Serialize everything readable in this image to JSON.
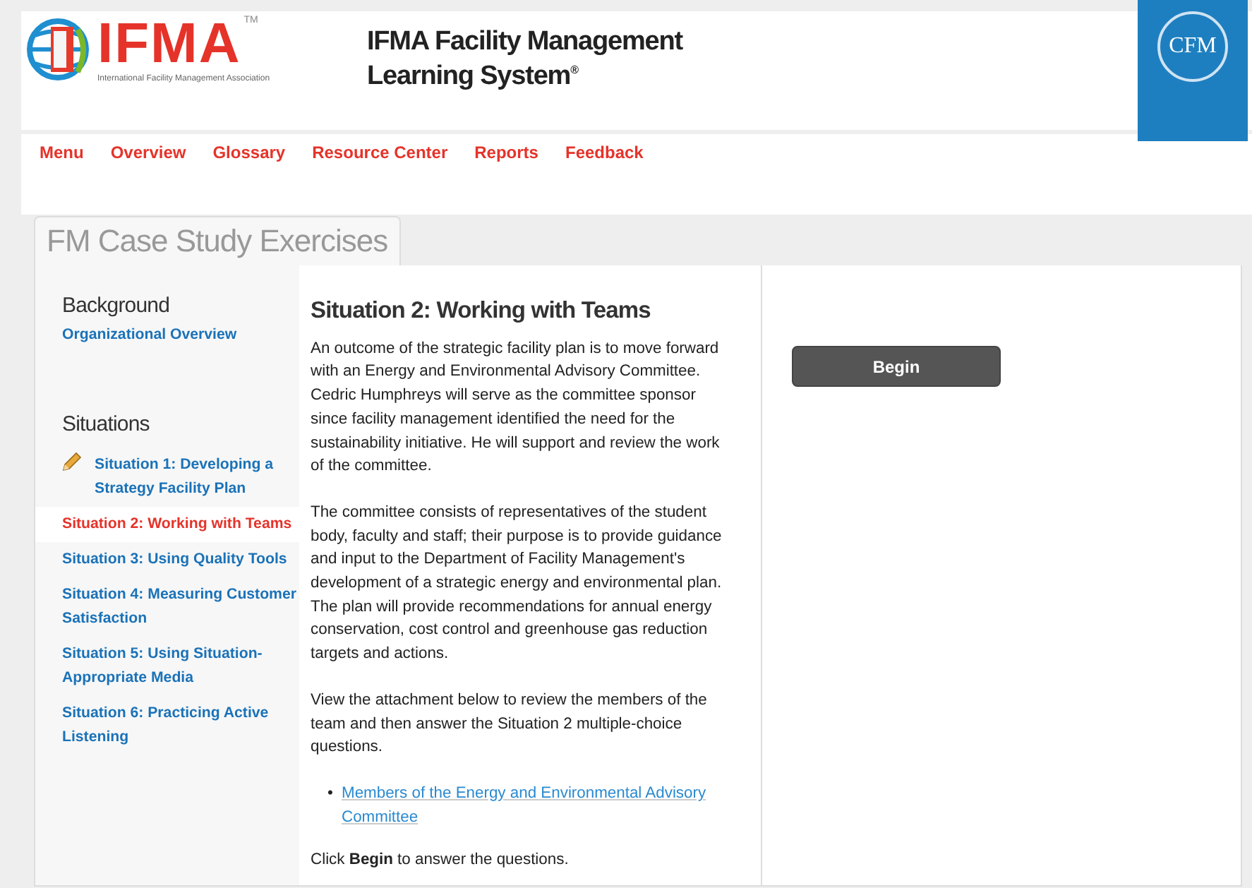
{
  "header": {
    "logo_text": "IFMA",
    "logo_tm": "TM",
    "logo_tagline": "International Facility Management Association",
    "title_line1": "IFMA Facility Management",
    "title_line2": "Learning System$^{®}$",
    "badge_text": "CFM"
  },
  "nav": [
    "Menu",
    "Overview",
    "Glossary",
    "Resource Center",
    "Reports",
    "Feedback"
  ],
  "tab": {
    "label": "FM Case Study Exercises"
  },
  "sidebar": {
    "background_heading": "Background",
    "background_items": [
      {
        "label": "Organizational Overview",
        "selected": false
      }
    ],
    "situations_heading": "Situations",
    "situations": [
      {
        "label": "Situation 1: Developing a Strategy Facility Plan",
        "selected": false,
        "in_progress": true
      },
      {
        "label": "Situation 2: Working with Teams",
        "selected": true,
        "in_progress": false
      },
      {
        "label": "Situation 3: Using Quality Tools",
        "selected": false,
        "in_progress": false
      },
      {
        "label": "Situation 4: Measuring Customer Satisfaction",
        "selected": false,
        "in_progress": false
      },
      {
        "label": "Situation 5: Using Situation-Appropriate Media",
        "selected": false,
        "in_progress": false
      },
      {
        "label": "Situation 6: Practicing Active Listening",
        "selected": false,
        "in_progress": false
      }
    ]
  },
  "content": {
    "heading": "Situation 2: Working with Teams",
    "paragraphs": [
      "An outcome of the strategic facility plan is to move forward with an Energy and Environmental Advisory Committee. Cedric Humphreys will serve as the committee sponsor since facility management identified the need for the sustainability initiative. He will support and review the work of the committee.",
      "The committee consists of representatives of the student body, faculty and staff; their purpose is to provide guidance and input to the Department of Facility Management's development of a strategic energy and environmental plan. The plan will provide recommendations for annual energy conservation, cost control and greenhouse gas reduction targets and actions.",
      "View the attachment below to review the members of the team and then answer the Situation 2 multiple-choice questions."
    ],
    "attachments": [
      {
        "bullet": "•",
        "label": "Members of the Energy and Environmental Advisory Committee"
      }
    ],
    "closing": "Click **Begin** to answer the questions."
  },
  "begin_button": "Begin"
}
